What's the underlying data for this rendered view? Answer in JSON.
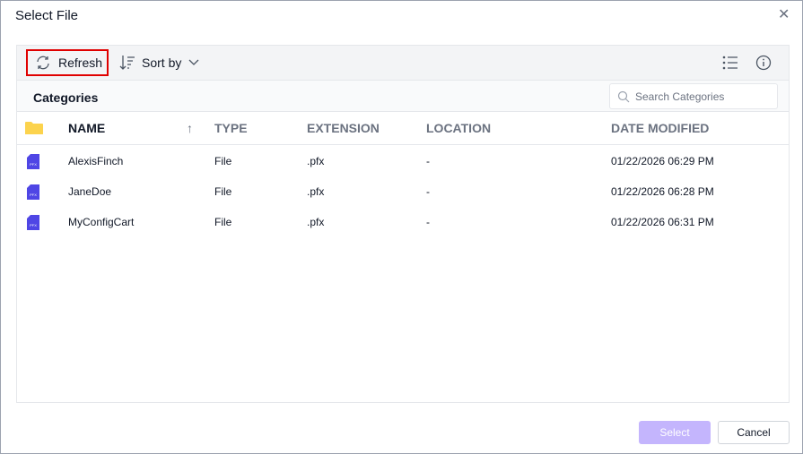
{
  "dialog": {
    "title": "Select File",
    "close_icon": "close-icon"
  },
  "toolbar": {
    "refresh_label": "Refresh",
    "sort_label": "Sort by"
  },
  "categories": {
    "label": "Categories",
    "search_placeholder": "Search Categories"
  },
  "columns": {
    "name": "NAME",
    "type": "TYPE",
    "extension": "EXTENSION",
    "location": "LOCATION",
    "date_modified": "DATE MODIFIED"
  },
  "files": [
    {
      "name": "AlexisFinch",
      "type": "File",
      "extension": ".pfx",
      "location": "-",
      "date_modified": "01/22/2026 06:29 PM"
    },
    {
      "name": "JaneDoe",
      "type": "File",
      "extension": ".pfx",
      "location": "-",
      "date_modified": "01/22/2026 06:28 PM"
    },
    {
      "name": "MyConfigCart",
      "type": "File",
      "extension": ".pfx",
      "location": "-",
      "date_modified": "01/22/2026 06:31 PM"
    }
  ],
  "file_icon_text": "PFX",
  "footer": {
    "select_label": "Select",
    "cancel_label": "Cancel"
  },
  "colors": {
    "accent": "#4f46e5",
    "select_disabled": "#c4b5fd",
    "highlight": "#e00000",
    "folder": "#fcd34d"
  }
}
